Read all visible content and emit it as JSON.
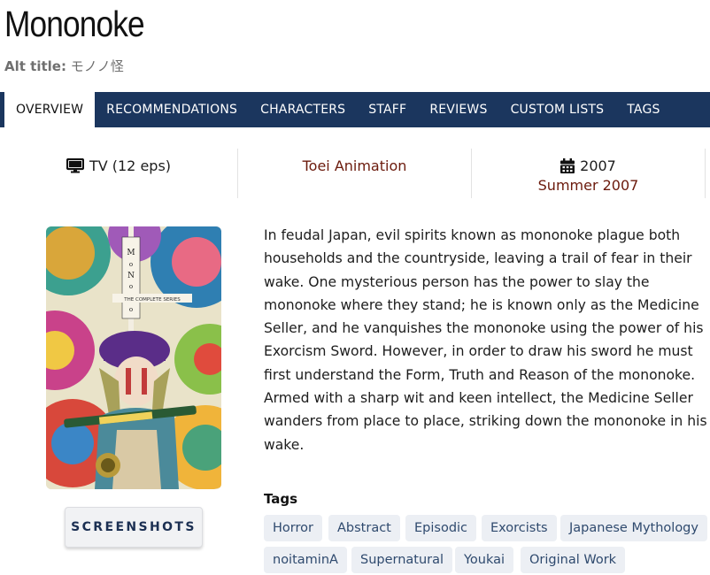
{
  "header": {
    "title": "Mononoke",
    "alt_title_label": "Alt title:",
    "alt_title_value": "モノノ怪"
  },
  "nav": {
    "tabs": [
      {
        "label": "OVERVIEW",
        "active": true
      },
      {
        "label": "RECOMMENDATIONS",
        "active": false
      },
      {
        "label": "CHARACTERS",
        "active": false
      },
      {
        "label": "STAFF",
        "active": false
      },
      {
        "label": "REVIEWS",
        "active": false
      },
      {
        "label": "CUSTOM LISTS",
        "active": false
      },
      {
        "label": "TAGS",
        "active": false
      }
    ]
  },
  "info": {
    "type": {
      "icon": "monitor-icon",
      "text": "TV (12 eps)"
    },
    "studio": {
      "text": "Toei Animation"
    },
    "date": {
      "icon": "calendar-icon",
      "year": "2007",
      "season": "Summer 2007"
    }
  },
  "poster": {
    "series_title_vertical": "Mo No No Ke",
    "banner": "THE COMPLETE SERIES"
  },
  "screenshots_button": "SCREENSHOTS",
  "synopsis": {
    "lines": [
      "In feudal Japan, evil spirits known as mononoke plague both",
      "households and the countryside, leaving a trail of fear in their",
      "wake. One mysterious person has the power to slay the",
      "mononoke where they stand; he is known only as the Medicine",
      "Seller, and he vanquishes the mononoke using the power of his",
      "Exorcism Sword. However, in order to draw his sword he must",
      "first understand the Form, Truth and Reason of the mononoke.",
      "Armed with a sharp wit and keen intellect, the Medicine Seller",
      "wanders from place to place, striking down the mononoke in his",
      "wake."
    ]
  },
  "tags": {
    "heading": "Tags",
    "items": [
      "Horror",
      "Abstract",
      "Episodic",
      "Exorcists",
      "Japanese Mythology",
      "noitaminA",
      "Supernatural",
      "Youkai",
      "Original Work"
    ]
  },
  "colors": {
    "nav_bg": "#1b365e",
    "link": "#6b1a0c",
    "tag_bg": "#eceff4",
    "tag_text": "#2f4a6e"
  }
}
